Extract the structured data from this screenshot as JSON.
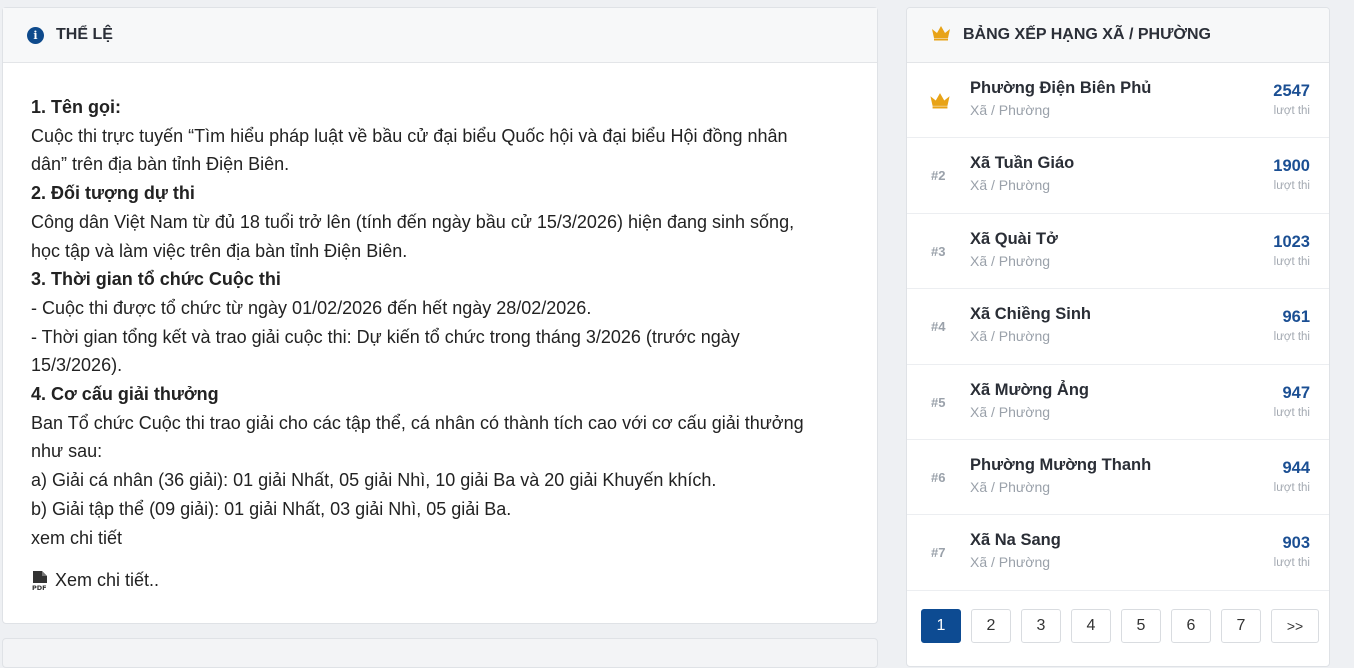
{
  "rules": {
    "title": "THỂ LỆ",
    "sections": [
      {
        "heading": "1. Tên gọi:",
        "lines": [
          "Cuộc thi trực tuyến “Tìm hiểu pháp luật về bầu cử đại biểu Quốc hội và đại biểu Hội đồng nhân",
          "dân” trên địa bàn tỉnh Điện Biên."
        ]
      },
      {
        "heading": "2. Đối tượng dự thi",
        "lines": [
          "Công dân Việt Nam từ đủ 18 tuổi trở lên (tính đến ngày bầu cử 15/3/2026) hiện đang sinh sống,",
          "học tập và làm việc trên địa bàn tỉnh Điện Biên."
        ]
      },
      {
        "heading": "3. Thời gian tổ chức Cuộc thi",
        "lines": [
          "- Cuộc thi được tổ chức từ ngày 01/02/2026 đến hết ngày 28/02/2026.",
          "- Thời gian tổng kết và trao giải cuộc thi: Dự kiến tổ chức trong tháng 3/2026 (trước ngày",
          "15/3/2026)."
        ]
      },
      {
        "heading": "4. Cơ cấu giải thưởng",
        "lines": [
          "Ban Tổ chức Cuộc thi trao giải cho các tập thể, cá nhân có thành tích cao với cơ cấu giải thưởng",
          "như sau:",
          "a) Giải cá nhân (36 giải): 01 giải Nhất, 05 giải Nhì, 10 giải Ba và 20 giải Khuyến khích.",
          "b) Giải tập thể (09 giải): 01 giải Nhất, 03 giải Nhì, 05 giải Ba.",
          "xem chi tiết"
        ]
      }
    ],
    "pdf_link_label": "Xem chi tiết.."
  },
  "ranking": {
    "title": "BẢNG XẾP HẠNG XÃ / PHƯỜNG",
    "items": [
      {
        "rank": "#1",
        "name": "Phường Điện Biên Phủ",
        "type": "Xã / Phường",
        "count": "2547",
        "unit": "lượt thi"
      },
      {
        "rank": "#2",
        "name": "Xã Tuần Giáo",
        "type": "Xã / Phường",
        "count": "1900",
        "unit": "lượt thi"
      },
      {
        "rank": "#3",
        "name": "Xã Quài Tở",
        "type": "Xã / Phường",
        "count": "1023",
        "unit": "lượt thi"
      },
      {
        "rank": "#4",
        "name": "Xã Chiềng Sinh",
        "type": "Xã / Phường",
        "count": "961",
        "unit": "lượt thi"
      },
      {
        "rank": "#5",
        "name": "Xã Mường Ảng",
        "type": "Xã / Phường",
        "count": "947",
        "unit": "lượt thi"
      },
      {
        "rank": "#6",
        "name": "Phường Mường Thanh",
        "type": "Xã / Phường",
        "count": "944",
        "unit": "lượt thi"
      },
      {
        "rank": "#7",
        "name": "Xã Na Sang",
        "type": "Xã / Phường",
        "count": "903",
        "unit": "lượt thi"
      }
    ],
    "pagination": {
      "pages": [
        "1",
        "2",
        "3",
        "4",
        "5",
        "6",
        "7"
      ],
      "active": "1",
      "next_label": ">>"
    }
  },
  "colors": {
    "accent": "#0d4b92",
    "crown": "#e8a317"
  }
}
